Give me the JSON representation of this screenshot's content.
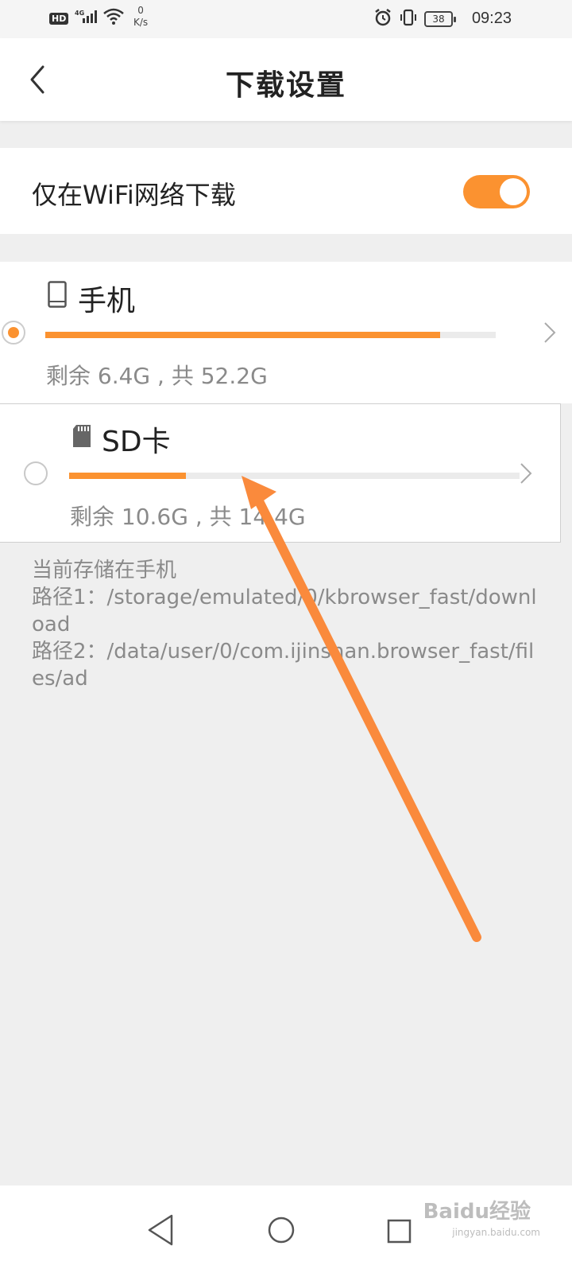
{
  "status_bar": {
    "hd": "HD",
    "network": "4G",
    "speed_value": "0",
    "speed_unit": "K/s",
    "battery": "38",
    "time": "09:23"
  },
  "header": {
    "title": "下载设置"
  },
  "wifi_only": {
    "label": "仅在WiFi网络下载",
    "enabled": true
  },
  "storage": [
    {
      "name": "手机",
      "info": "剩余 6.4G , 共 52.2G",
      "used_fraction": 0.877,
      "selected": true,
      "icon": "phone-icon"
    },
    {
      "name": "SD卡",
      "info": "剩余 10.6G , 共 14.4G",
      "used_fraction": 0.26,
      "selected": false,
      "icon": "sd-card-icon"
    }
  ],
  "info": {
    "current": "当前存储在手机",
    "path1": "路径1：/storage/emulated/0/kbrowser_fast/download",
    "path2": "路径2：/data/user/0/com.ijinshan.browser_fast/files/ad"
  },
  "watermark": {
    "brand": "Baidu经验",
    "url": "jingyan.baidu.com"
  },
  "colors": {
    "accent": "#fb9230",
    "annotation": "#fa8a3c"
  }
}
